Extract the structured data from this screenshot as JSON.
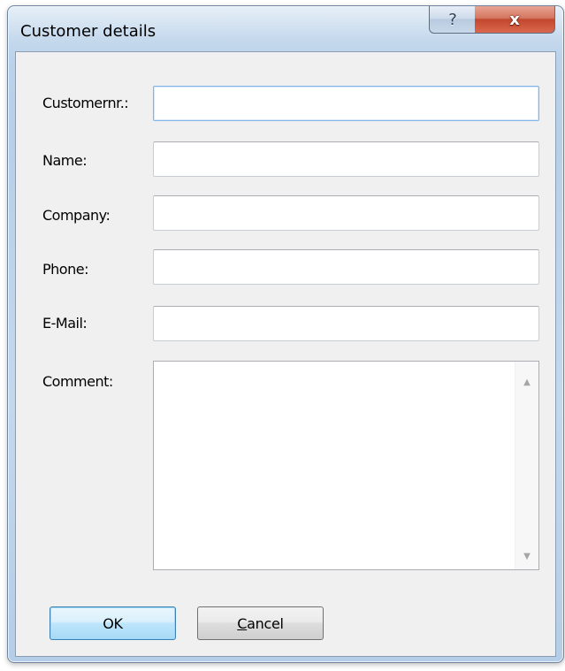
{
  "window": {
    "title": "Customer details",
    "help_glyph": "?",
    "close_glyph": "x"
  },
  "form": {
    "fields": [
      {
        "label": "Customernr.:",
        "value": ""
      },
      {
        "label": "Name:",
        "value": ""
      },
      {
        "label": "Company:",
        "value": ""
      },
      {
        "label": "Phone:",
        "value": ""
      },
      {
        "label": "E-Mail:",
        "value": ""
      }
    ],
    "comment": {
      "label": "Comment:",
      "value": ""
    }
  },
  "buttons": {
    "ok_label": "OK",
    "cancel_accel": "C",
    "cancel_rest": "ancel"
  },
  "icons": {
    "help": "help-icon",
    "close": "close-icon",
    "scroll_up": "scroll-up-arrow-icon",
    "scroll_down": "scroll-down-arrow-icon"
  },
  "colors": {
    "default_button_border": "#3c7fb1",
    "focus_border": "#7eb4ea",
    "close_button": "#c3472f"
  }
}
